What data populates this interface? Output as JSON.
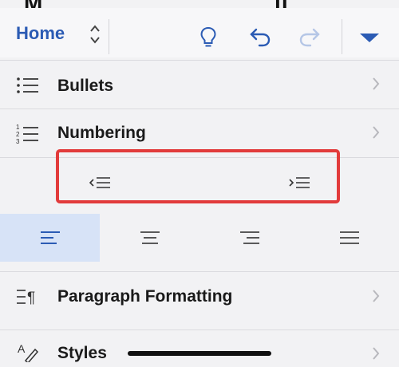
{
  "toolbar": {
    "home_label": "Home",
    "icons": [
      "lightbulb-icon",
      "undo-icon",
      "redo-icon",
      "dropdown-triangle-icon"
    ],
    "accent_color": "#2b5bb4"
  },
  "menu": {
    "bullets_label": "Bullets",
    "numbering_label": "Numbering",
    "paragraph_label": "Paragraph Formatting",
    "styles_label": "Styles"
  },
  "indent": {
    "decrease_icon": "decrease-indent-icon",
    "increase_icon": "increase-indent-icon",
    "highlight_color": "#e23b3b"
  },
  "alignment": {
    "options": [
      "align-left",
      "align-center",
      "align-right",
      "justify"
    ],
    "selected": "align-left",
    "selected_bg": "#d7e3f7"
  }
}
